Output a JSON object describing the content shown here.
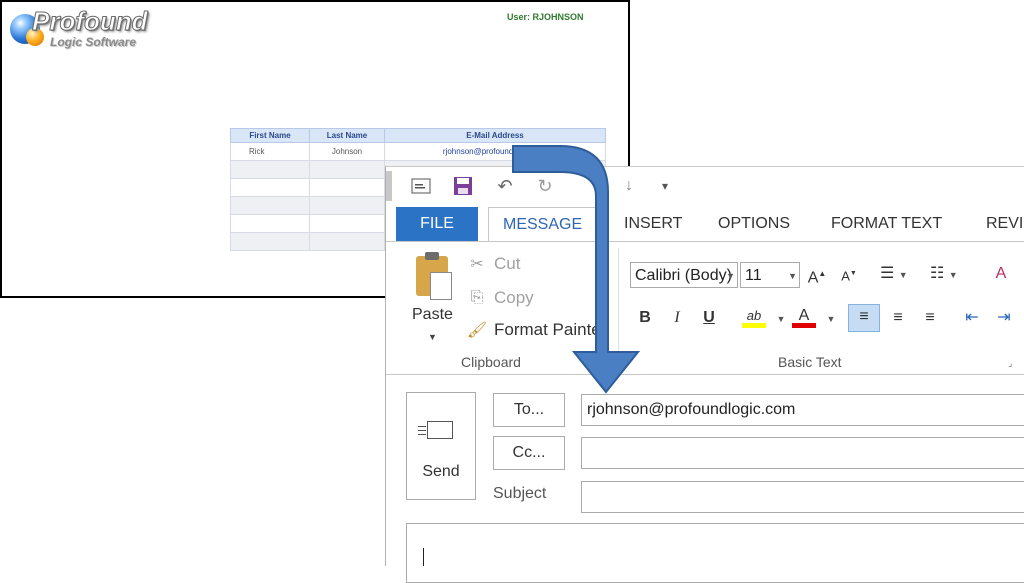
{
  "app": {
    "logo_line1": "Profound",
    "logo_line2": "Logic Software",
    "user_label": "User: RJOHNSON",
    "grid": {
      "columns": [
        "First Name",
        "Last Name",
        "E-Mail Address"
      ],
      "rows": [
        [
          "Rick",
          "Johnson",
          "rjohnson@profoundlogic.com"
        ],
        [
          "",
          "",
          ""
        ],
        [
          "",
          "",
          ""
        ],
        [
          "",
          "",
          ""
        ],
        [
          "",
          "",
          ""
        ],
        [
          "",
          "",
          ""
        ]
      ]
    }
  },
  "outlook": {
    "tabs": {
      "file": "FILE",
      "message": "MESSAGE",
      "insert": "INSERT",
      "options": "OPTIONS",
      "format_text": "FORMAT TEXT",
      "review": "REVIEW"
    },
    "clipboard": {
      "paste": "Paste",
      "cut": "Cut",
      "copy": "Copy",
      "format_painter": "Format Painter",
      "group_label": "Clipboard"
    },
    "basic_text": {
      "font_name": "Calibri (Body)",
      "font_size": "11",
      "bold": "B",
      "italic": "I",
      "underline": "U",
      "group_label": "Basic Text"
    },
    "send": "Send",
    "to_button": "To...",
    "cc_button": "Cc...",
    "subject_label": "Subject",
    "to_value": "rjohnson@profoundlogic.com",
    "cc_value": "",
    "subject_value": ""
  },
  "colors": {
    "file_tab": "#2b73c4",
    "arrow": "#4a7fc4",
    "highlight": "#ffff00",
    "font_color": "#e00000"
  }
}
